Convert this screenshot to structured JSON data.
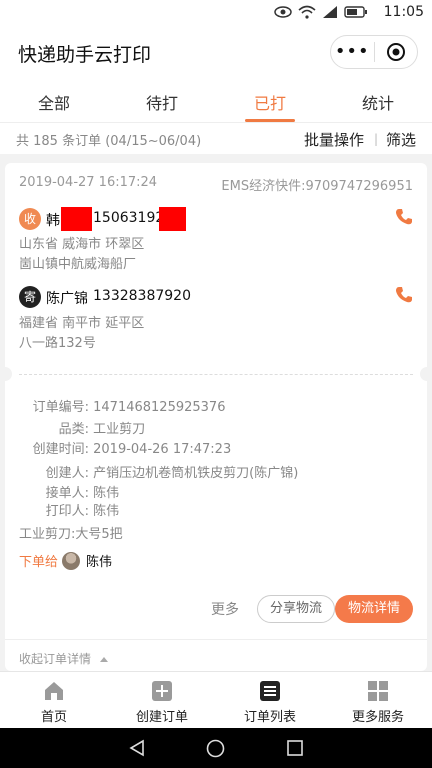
{
  "status_bar": {
    "time": "11:05"
  },
  "app": {
    "title": "快递助手云打印"
  },
  "tabs": [
    {
      "label": "全部"
    },
    {
      "label": "待打"
    },
    {
      "label": "已打"
    },
    {
      "label": "统计"
    }
  ],
  "summary": {
    "count_text": "共 185 条订单 (04/15~06/04)",
    "batch_label": "批量操作",
    "divider": "|",
    "filter_label": "筛选"
  },
  "order": {
    "timestamp": "2019-04-27 16:17:24",
    "express": "EMS经济快件:9709747296951",
    "recipient": {
      "badge": "收",
      "name": "韩",
      "phone": "150631927",
      "address_line1": "山东省 威海市 环翠区",
      "address_line2": "崮山镇中航威海船厂"
    },
    "sender": {
      "badge": "寄",
      "name": "陈广锦",
      "phone": "13328387920",
      "address_line1": "福建省 南平市 延平区",
      "address_line2": "八一路132号"
    },
    "details": {
      "order_no_label": "订单编号:",
      "order_no": "1471468125925376",
      "category_label": "品类:",
      "category": "工业剪刀",
      "created_time_label": "创建时间:",
      "created_time": "2019-04-26 17:47:23",
      "creator_label": "创建人:",
      "creator": "产销压边机卷筒机铁皮剪刀(陈广锦)",
      "receiver_label": "接单人:",
      "receiver": "陈伟",
      "printer_label": "打印人:",
      "printer": "陈伟",
      "goods": "工业剪刀:大号5把"
    },
    "assign_label": "下单给",
    "assign_name": "陈伟",
    "more_label": "更多",
    "share_label": "分享物流",
    "logistics_label": "物流详情",
    "collapse_label": "收起订单详情"
  },
  "bottom_nav": [
    {
      "label": "首页",
      "icon": "home-icon"
    },
    {
      "label": "创建订单",
      "icon": "plus-square-icon"
    },
    {
      "label": "订单列表",
      "icon": "list-icon"
    },
    {
      "label": "更多服务",
      "icon": "grid-icon"
    }
  ],
  "colors": {
    "accent": "#f07a42",
    "recipient_badge": "#f08a52",
    "sender_badge": "#222222"
  }
}
